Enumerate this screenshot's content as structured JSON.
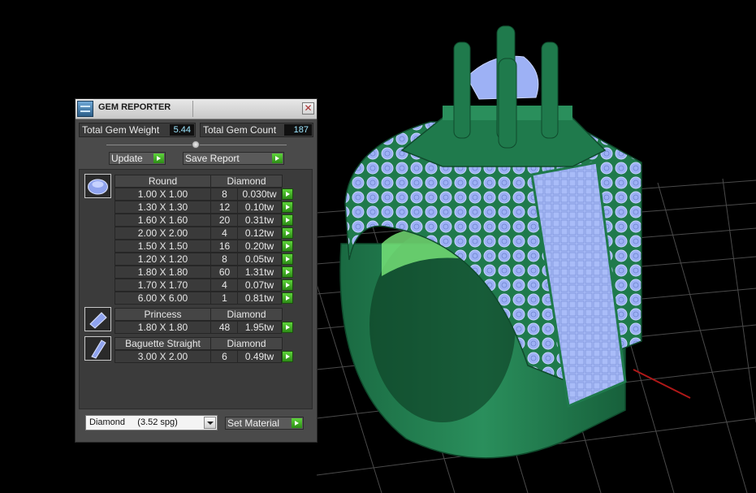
{
  "window": {
    "title": "GEM REPORTER",
    "close_glyph": "✕",
    "icon": "gem-reporter-icon"
  },
  "summary": {
    "weight_label": "Total Gem Weight",
    "weight_value": "5.44",
    "count_label": "Total Gem Count",
    "count_value": "187"
  },
  "toolbar": {
    "update_label": "Update",
    "save_label": "Save Report"
  },
  "groups": [
    {
      "shape": "Round",
      "material": "Diamond",
      "icon": "round-gem-icon",
      "rows": [
        {
          "size": "1.00 X 1.00",
          "count": "8",
          "weight": "0.030tw"
        },
        {
          "size": "1.30 X 1.30",
          "count": "12",
          "weight": "0.10tw"
        },
        {
          "size": "1.60 X 1.60",
          "count": "20",
          "weight": "0.31tw"
        },
        {
          "size": "2.00 X 2.00",
          "count": "4",
          "weight": "0.12tw"
        },
        {
          "size": "1.50 X 1.50",
          "count": "16",
          "weight": "0.20tw"
        },
        {
          "size": "1.20 X 1.20",
          "count": "8",
          "weight": "0.05tw"
        },
        {
          "size": "1.80 X 1.80",
          "count": "60",
          "weight": "1.31tw"
        },
        {
          "size": "1.70 X 1.70",
          "count": "4",
          "weight": "0.07tw"
        },
        {
          "size": "6.00 X 6.00",
          "count": "1",
          "weight": "0.81tw"
        }
      ]
    },
    {
      "shape": "Princess",
      "material": "Diamond",
      "icon": "princess-gem-icon",
      "rows": [
        {
          "size": "1.80 X 1.80",
          "count": "48",
          "weight": "1.95tw"
        }
      ]
    },
    {
      "shape": "Baguette Straight",
      "material": "Diamond",
      "icon": "baguette-gem-icon",
      "rows": [
        {
          "size": "3.00 X 2.00",
          "count": "6",
          "weight": "0.49tw"
        }
      ]
    }
  ],
  "footer": {
    "material_value": "Diamond     (3.52 spg)",
    "set_material_label": "Set Material"
  },
  "colors": {
    "ring_green": "#1f7a4c",
    "gem_blue": "#9db1f5",
    "grid": "#4a4a4a",
    "value_text": "#9ee7ff",
    "go_button": "#3fb021"
  }
}
